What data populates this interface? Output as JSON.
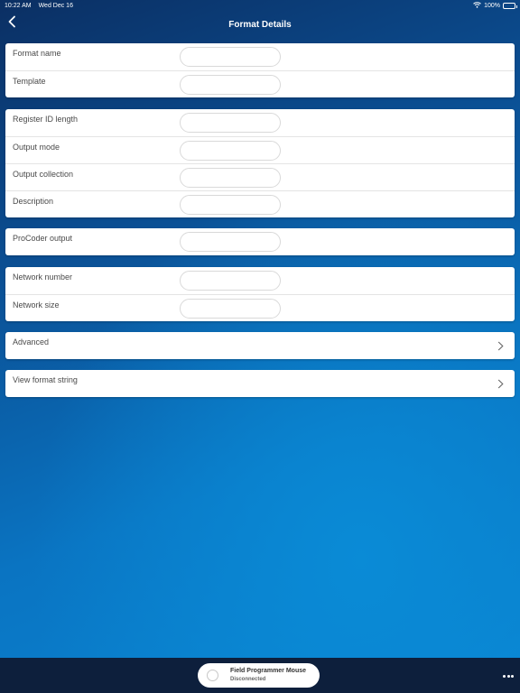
{
  "status_bar": {
    "time": "10:22 AM",
    "date": "Wed Dec 16",
    "battery": "100%",
    "wifi_icon": "wifi-icon",
    "battery_icon": "battery-icon"
  },
  "nav": {
    "title": "Format Details",
    "back_icon": "chevron-left-icon"
  },
  "sections": {
    "basic": {
      "format_name_label": "Format name",
      "format_name_value": "",
      "template_label": "Template",
      "template_value": ""
    },
    "register": {
      "register_id_length_label": "Register ID length",
      "register_id_length_value": "",
      "output_mode_label": "Output mode",
      "output_mode_value": "",
      "output_collection_label": "Output collection",
      "output_collection_value": "",
      "description_label": "Description",
      "description_value": ""
    },
    "procoder": {
      "procoder_output_label": "ProCoder output",
      "procoder_output_value": ""
    },
    "network": {
      "network_number_label": "Network number",
      "network_number_value": "",
      "network_size_label": "Network size",
      "network_size_value": ""
    },
    "advanced_label": "Advanced",
    "view_format_string_label": "View format string"
  },
  "bottom_bar": {
    "device_name": "Field Programmer Mouse",
    "device_state": "Disconnected",
    "more_icon": "more-horizontal-icon"
  },
  "colors": {
    "background_dark": "#0b2f63",
    "background_light": "#0a86d3",
    "bottom_bar": "#0d1f3c",
    "card": "#ffffff"
  }
}
